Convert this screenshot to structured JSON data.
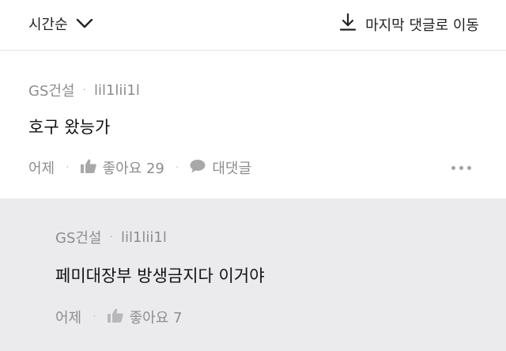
{
  "topbar": {
    "sort_label": "시간순",
    "sort_icon": "chevron-down-icon",
    "jump_label": "마지막 댓글로 이동",
    "jump_icon": "download-arrow-icon"
  },
  "comment": {
    "author": "GS건설",
    "user_id": "lil1lii1l",
    "text": "호구 왔능가",
    "time": "어제",
    "like_label": "좋아요 29",
    "reply_label": "대댓글",
    "more_icon": "more-dots-icon"
  },
  "reply": {
    "author": "GS건설",
    "user_id": "lil1lii1l",
    "text": "페미대장부 방생금지다 이거야",
    "time": "어제",
    "like_label": "좋아요 7"
  },
  "colors": {
    "reply_background": "#ebebed",
    "meta_text": "#8d8d8d"
  }
}
